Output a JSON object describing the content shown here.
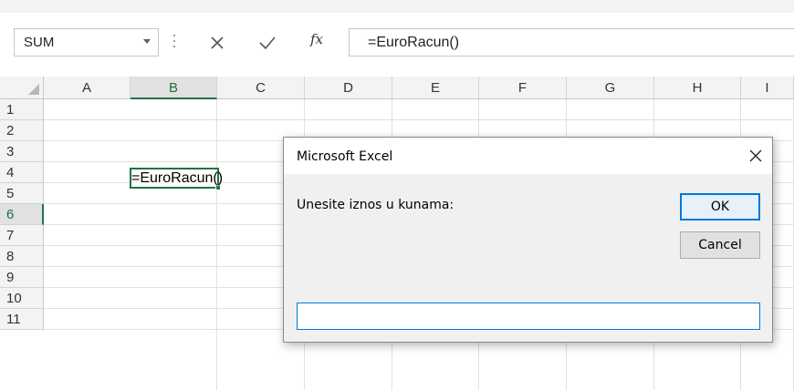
{
  "formula_bar": {
    "name_box": "SUM",
    "formula": "=EuroRacun()"
  },
  "icons": {
    "name_box_dropdown": "chevron-down-icon",
    "cancel": "close-icon",
    "enter": "checkmark-icon",
    "insert_function": "fx-icon",
    "fx_glyph": "fx",
    "select_all": "select-all-triangle-icon"
  },
  "grid": {
    "columns": [
      "A",
      "B",
      "C",
      "D",
      "E",
      "F",
      "G",
      "H",
      "I"
    ],
    "rows": [
      "1",
      "2",
      "3",
      "4",
      "5",
      "6",
      "7",
      "8",
      "9",
      "10",
      "11"
    ],
    "selected_column": "B",
    "selected_row": "6",
    "active_cell_text": "=EuroRacun()"
  },
  "dialog": {
    "title": "Microsoft Excel",
    "close_glyph": "✕",
    "prompt": "Unesite iznos u kunama:",
    "ok_label": "OK",
    "cancel_label": "Cancel",
    "input_value": ""
  },
  "colors": {
    "excel_green": "#217346",
    "focus_blue": "#0078d7",
    "dialog_bg": "#f0f0f0",
    "header_bg": "#f3f3f3"
  }
}
